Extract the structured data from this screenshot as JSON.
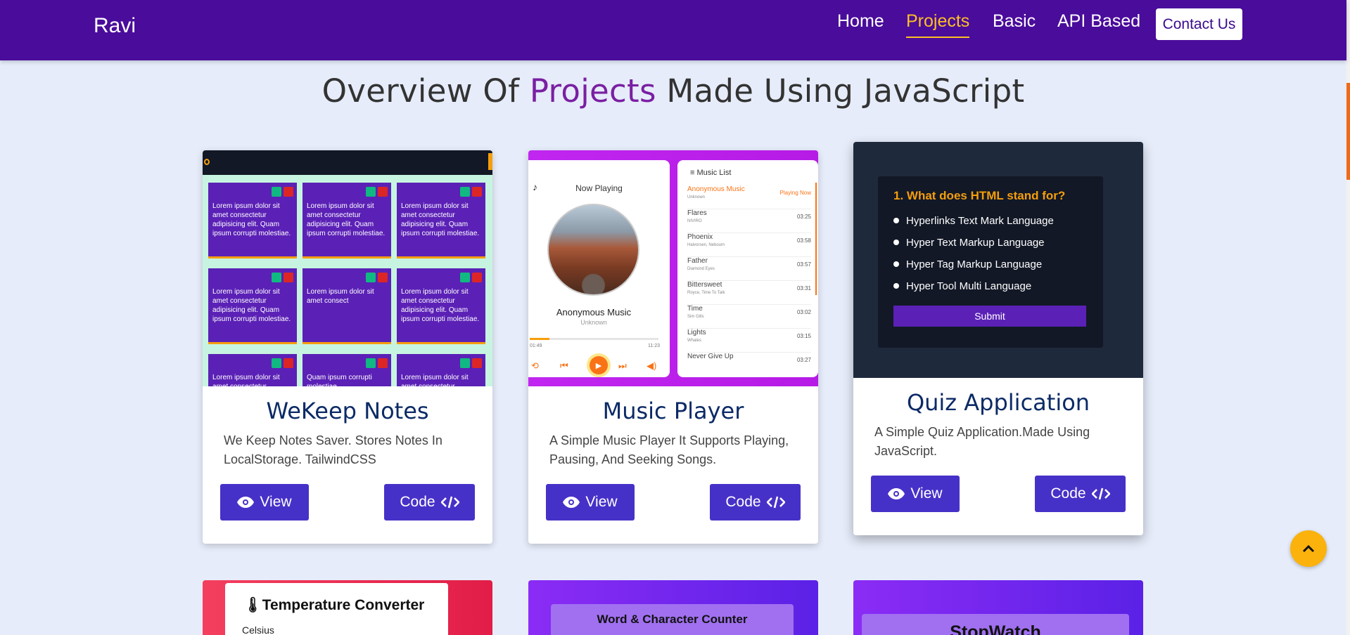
{
  "navbar": {
    "brand": "Ravi",
    "links": [
      "Home",
      "Projects",
      "Basic",
      "API Based"
    ],
    "active": "Projects",
    "contact_label": "Contact Us"
  },
  "heading": {
    "part1": "Overview Of ",
    "highlight": "Projects",
    "part2": " Made Using JavaScript"
  },
  "cards": [
    {
      "title": "WeKeep Notes",
      "description": "We Keep Notes Saver. Stores Notes In LocalStorage. TailwindCSS",
      "view_label": "View",
      "code_label": "Code",
      "preview": {
        "notes": [
          "Lorem ipsum dolor sit amet consectetur adipisicing elit. Quam ipsum corrupti molestiae.",
          "Lorem ipsum dolor sit amet consectetur adipisicing elit. Quam ipsum corrupti molestiae.",
          "Lorem ipsum dolor sit amet consectetur adipisicing elit. Quam ipsum corrupti molestiae.",
          "Lorem ipsum dolor sit amet consectetur adipisicing elit. Quam ipsum corrupti molestiae.",
          "Lorem ipsum dolor sit amet consect",
          "Lorem ipsum dolor sit amet consectetur adipisicing elit. Quam ipsum corrupti molestiae.",
          "Lorem ipsum dolor sit amet consectetur",
          "Quam ipsum corrupti molestiae.",
          "Lorem ipsum dolor sit amet consectetur"
        ]
      }
    },
    {
      "title": "Music Player",
      "description": "A Simple Music Player It Supports Playing, Pausing, And Seeking Songs.",
      "view_label": "View",
      "code_label": "Code",
      "preview": {
        "now_playing": "Now Playing",
        "song": "Anonymous Music",
        "artist": "Unknown",
        "time_current": "01:49",
        "time_total": "11:23",
        "list_title": "Music List",
        "playing_now": "Playing Now",
        "list": [
          {
            "name": "Anonymous Music",
            "artist": "Unknown",
            "duration": ""
          },
          {
            "name": "Flares",
            "artist": "NIVIRO",
            "duration": "03:25"
          },
          {
            "name": "Phoenix",
            "artist": "Halvorsen, Neboum",
            "duration": "03:58"
          },
          {
            "name": "Father",
            "artist": "Diamond Eyes",
            "duration": "03:57"
          },
          {
            "name": "Bittersweet",
            "artist": "Royce, Time To Talk",
            "duration": "03:31"
          },
          {
            "name": "Time",
            "artist": "Sim Gills",
            "duration": "03:02"
          },
          {
            "name": "Lights",
            "artist": "Whales",
            "duration": "03:15"
          },
          {
            "name": "Never Give Up",
            "artist": "",
            "duration": "03:27"
          }
        ]
      }
    },
    {
      "title": "Quiz Application",
      "description": "A Simple Quiz Application.Made Using JavaScript.",
      "view_label": "View",
      "code_label": "Code",
      "preview": {
        "question": "1. What does HTML stand for?",
        "options": [
          "Hyperlinks Text Mark Language",
          "Hyper Text Markup Language",
          "Hyper Tag Markup Language",
          "Hyper Tool Multi Language"
        ],
        "submit": "Submit"
      }
    }
  ],
  "bottom_cards": {
    "temperature_title": "Temperature Converter",
    "temperature_label": "Celsius",
    "word_counter_title": "Word & Character Counter",
    "stopwatch_title": "StopWatch"
  },
  "icons": {
    "view": "eye-icon",
    "code": "code-icon",
    "scroll_top": "chevron-up-icon",
    "thermometer": "thermometer-icon"
  },
  "colors": {
    "navbar": "#4a0c9b",
    "accent": "#fbbf24",
    "button": "#4631c8",
    "title": "#0b2a66",
    "highlight": "#7a1fa2",
    "page_bg": "#e6ecfa"
  }
}
